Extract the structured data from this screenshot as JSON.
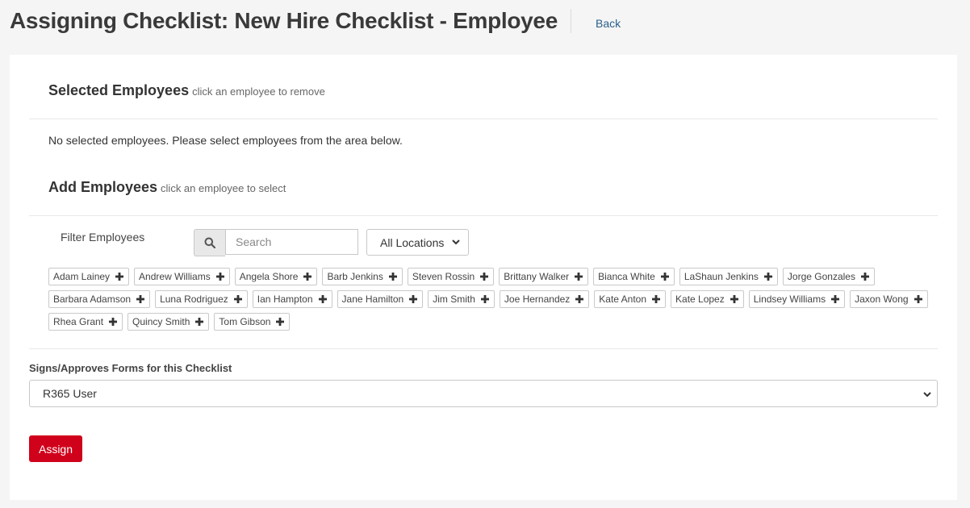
{
  "header": {
    "title": "Assigning Checklist: New Hire Checklist - Employee",
    "back_label": "Back"
  },
  "selected": {
    "title": "Selected Employees",
    "hint": "click an employee to remove",
    "empty_message": "No selected employees. Please select employees from the area below."
  },
  "add": {
    "title": "Add Employees",
    "hint": "click an employee to select"
  },
  "filter": {
    "label": "Filter Employees",
    "search_placeholder": "Search",
    "search_value": "",
    "location_value": "All Locations"
  },
  "employees": {
    "row1": [
      "Adam Lainey",
      "Andrew Williams",
      "Angela Shore",
      "Barb Jenkins",
      "Steven Rossin",
      "Brittany Walker",
      "Bianca White",
      "LaShaun Jenkins",
      "Jorge Gonzales"
    ],
    "row2": [
      "Barbara Adamson",
      "Luna Rodriguez",
      "Ian Hampton",
      "Jane Hamilton",
      "Jim Smith",
      "Joe Hernandez",
      "Kate Anton",
      "Kate Lopez",
      "Lindsey Williams",
      "Jaxon Wong"
    ],
    "row3": [
      "Rhea Grant",
      "Quincy Smith",
      "Tom Gibson"
    ]
  },
  "signs": {
    "label": "Signs/Approves Forms for this Checklist",
    "value": "R365 User"
  },
  "actions": {
    "assign_label": "Assign"
  },
  "colors": {
    "accent": "#d0021b",
    "link": "#2a5f8a"
  },
  "icons": {
    "search": "search-icon",
    "add": "plus-icon",
    "dropdown": "chevron-down-icon"
  }
}
